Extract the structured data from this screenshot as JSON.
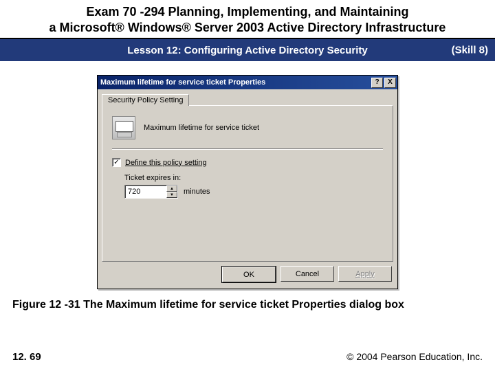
{
  "slide": {
    "title_line1": "Exam 70 -294 Planning, Implementing, and Maintaining",
    "title_line2": "a Microsoft® Windows® Server 2003 Active Directory Infrastructure",
    "lesson": "Lesson 12: Configuring Active Directory Security",
    "skill": "(Skill 8)",
    "figure_caption": "Figure 12 -31 The Maximum lifetime for service ticket Properties dialog box",
    "page_number": "12. 69",
    "copyright": "© 2004 Pearson Education, Inc."
  },
  "dialog": {
    "title": "Maximum lifetime for service ticket Properties",
    "help_glyph": "?",
    "close_glyph": "X",
    "tab_label": "Security Policy Setting",
    "policy_name": "Maximum lifetime for service ticket",
    "checkbox_mark": "✓",
    "define_label": "Define this policy setting",
    "expires_label": "Ticket expires in:",
    "ticket_value": "720",
    "units": "minutes",
    "spin_up": "▲",
    "spin_down": "▼",
    "ok": "OK",
    "cancel": "Cancel",
    "apply": "Apply"
  }
}
